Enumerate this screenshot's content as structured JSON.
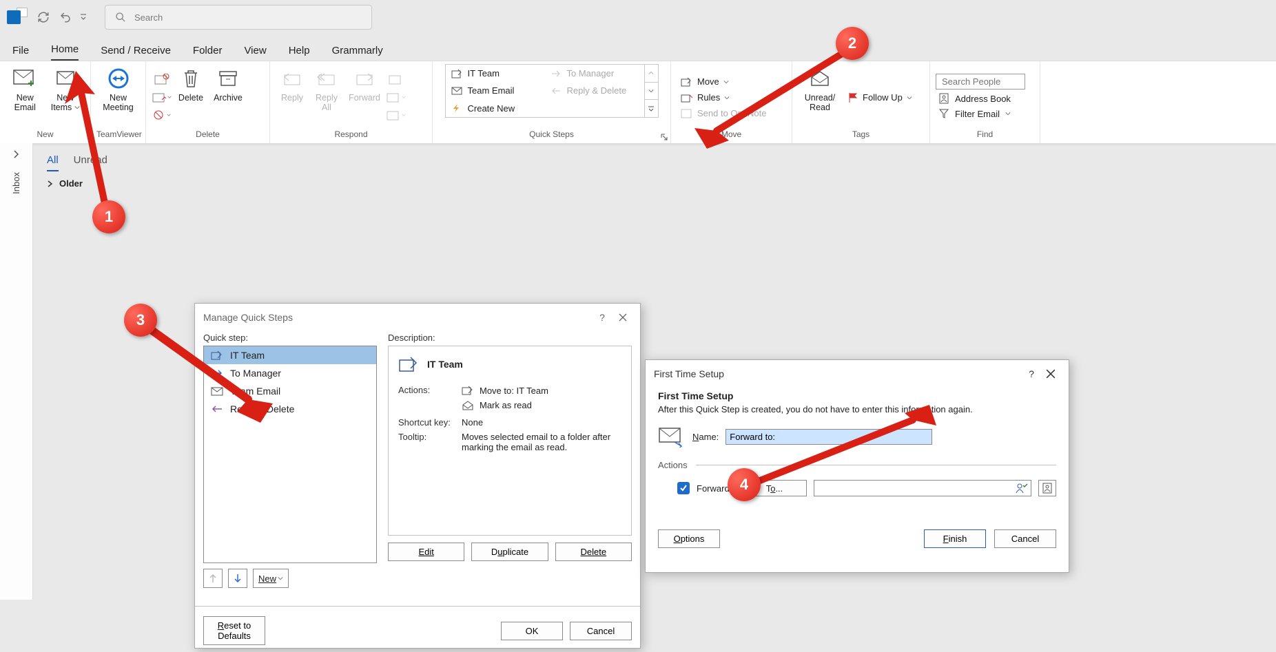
{
  "qat": {
    "search_placeholder": "Search"
  },
  "tabs": [
    "File",
    "Home",
    "Send / Receive",
    "Folder",
    "View",
    "Help",
    "Grammarly"
  ],
  "active_tab_index": 1,
  "ribbon": {
    "new": {
      "label": "New",
      "new_email": "New\nEmail",
      "new_items": "New\nItems"
    },
    "teamviewer": {
      "label": "TeamViewer",
      "new_meeting": "New\nMeeting"
    },
    "delete": {
      "label": "Delete",
      "delete": "Delete",
      "archive": "Archive"
    },
    "respond": {
      "label": "Respond",
      "reply": "Reply",
      "reply_all": "Reply\nAll",
      "forward": "Forward"
    },
    "quicksteps": {
      "label": "Quick Steps",
      "items_left": [
        "IT Team",
        "Team Email",
        "Create New"
      ],
      "items_right": [
        "To Manager",
        "Reply & Delete"
      ]
    },
    "move": {
      "label": "Move",
      "move": "Move",
      "rules": "Rules",
      "onenote": "Send to OneNote"
    },
    "tags": {
      "label": "Tags",
      "unread_read": "Unread/\nRead",
      "follow_up": "Follow Up"
    },
    "find": {
      "label": "Find",
      "search_people": "Search People",
      "address_book": "Address Book",
      "filter_email": "Filter Email"
    }
  },
  "nav": {
    "inbox_label": "Inbox"
  },
  "filters": {
    "all": "All",
    "unread": "Unread",
    "older": "Older"
  },
  "mqs": {
    "title": "Manage Quick Steps",
    "quickstep_label": "Quick step:",
    "description_label": "Description:",
    "list": [
      {
        "name": "IT Team",
        "icon": "move"
      },
      {
        "name": "To Manager",
        "icon": "forward"
      },
      {
        "name": "Team Email",
        "icon": "mail"
      },
      {
        "name": "Reply & Delete",
        "icon": "reply"
      }
    ],
    "selected_index": 0,
    "desc": {
      "title": "IT Team",
      "actions_label": "Actions:",
      "action1": "Move to: IT Team",
      "action2": "Mark as read",
      "shortcut_label": "Shortcut key:",
      "shortcut_val": "None",
      "tooltip_label": "Tooltip:",
      "tooltip_val": "Moves selected email to a folder after marking the email as read."
    },
    "new_btn": "New",
    "edit": "Edit",
    "duplicate": "Duplicate",
    "delete": "Delete",
    "reset": "Reset to Defaults",
    "ok": "OK",
    "cancel": "Cancel"
  },
  "fts": {
    "title": "First Time Setup",
    "heading": "First Time Setup",
    "sub": "After this Quick Step is created, you do not have to enter this information again.",
    "name_label": "Name:",
    "name_value": "Forward to:",
    "actions_label": "Actions",
    "forward_label": "Forward",
    "to_btn": "To...",
    "options": "Options",
    "finish": "Finish",
    "cancel": "Cancel"
  },
  "badges": {
    "b1": "1",
    "b2": "2",
    "b3": "3",
    "b4": "4"
  }
}
